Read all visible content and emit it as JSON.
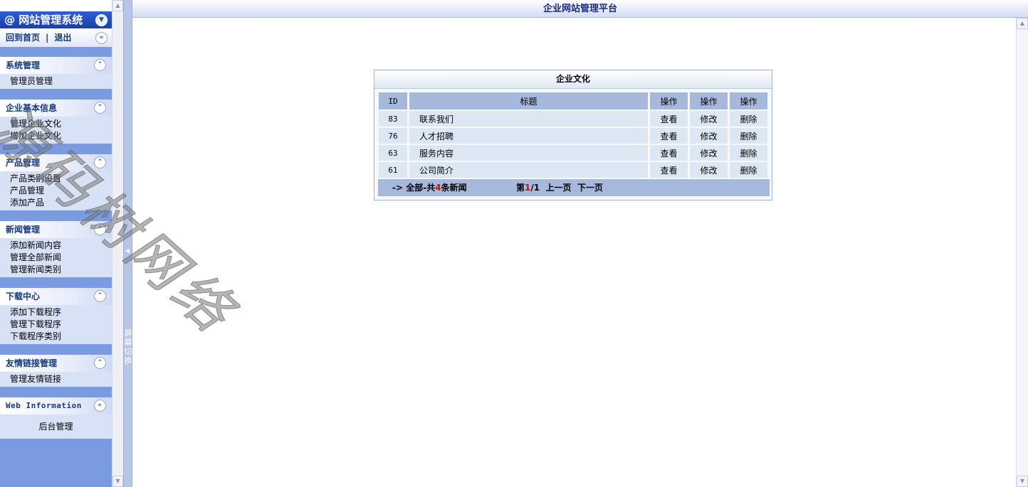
{
  "left_menu": {
    "system_title": "@ 网站管理系统",
    "home_link": "回到首页",
    "separator": "|",
    "logout_link": "退出",
    "groups": [
      {
        "title": "系统管理",
        "items": [
          "管理员管理"
        ]
      },
      {
        "title": "企业基本信息",
        "items": [
          "管理企业文化",
          "增加企业文化"
        ]
      },
      {
        "title": "产品管理",
        "items": [
          "产品类别设置",
          "产品管理",
          "添加产品"
        ]
      },
      {
        "title": "新闻管理",
        "items": [
          "添加新闻内容",
          "管理全部新闻",
          "管理新闻类别"
        ]
      },
      {
        "title": "下载中心",
        "items": [
          "添加下载程序",
          "管理下载程序",
          "下载程序类别"
        ]
      },
      {
        "title": "友情链接管理",
        "items": [
          "管理友情链接"
        ]
      }
    ],
    "web_info": {
      "title": "Web Information",
      "body": "后台管理"
    }
  },
  "splitter": {
    "switch_label": "屏幕切换"
  },
  "main": {
    "title": "企业网站管理平台",
    "panel_title": "企业文化",
    "columns": [
      "ID",
      "标题",
      "操作",
      "操作",
      "操作"
    ],
    "rows": [
      {
        "id": "83",
        "title": "联系我们",
        "view": "查看",
        "edit": "修改",
        "delete": "删除"
      },
      {
        "id": "76",
        "title": "人才招聘",
        "view": "查看",
        "edit": "修改",
        "delete": "删除"
      },
      {
        "id": "63",
        "title": "服务内容",
        "view": "查看",
        "edit": "修改",
        "delete": "删除"
      },
      {
        "id": "61",
        "title": "公司简介",
        "view": "查看",
        "edit": "修改",
        "delete": "删除"
      }
    ],
    "pager": {
      "total_prefix": "-> 全部-共",
      "total_count": "4",
      "total_suffix": "条新闻",
      "page_prefix": "第",
      "current_page": "1",
      "page_suffix": "/1",
      "prev": "上一页",
      "next": "下一页"
    }
  },
  "watermark": "源码树网络",
  "colors": {
    "menu_background": "#7a9be0",
    "header_blue": "#1a3fa8",
    "table_header": "#a6b9dc",
    "table_cell": "#dde7f3",
    "title_text": "#1b2a7a",
    "highlight_red": "#e00000"
  }
}
